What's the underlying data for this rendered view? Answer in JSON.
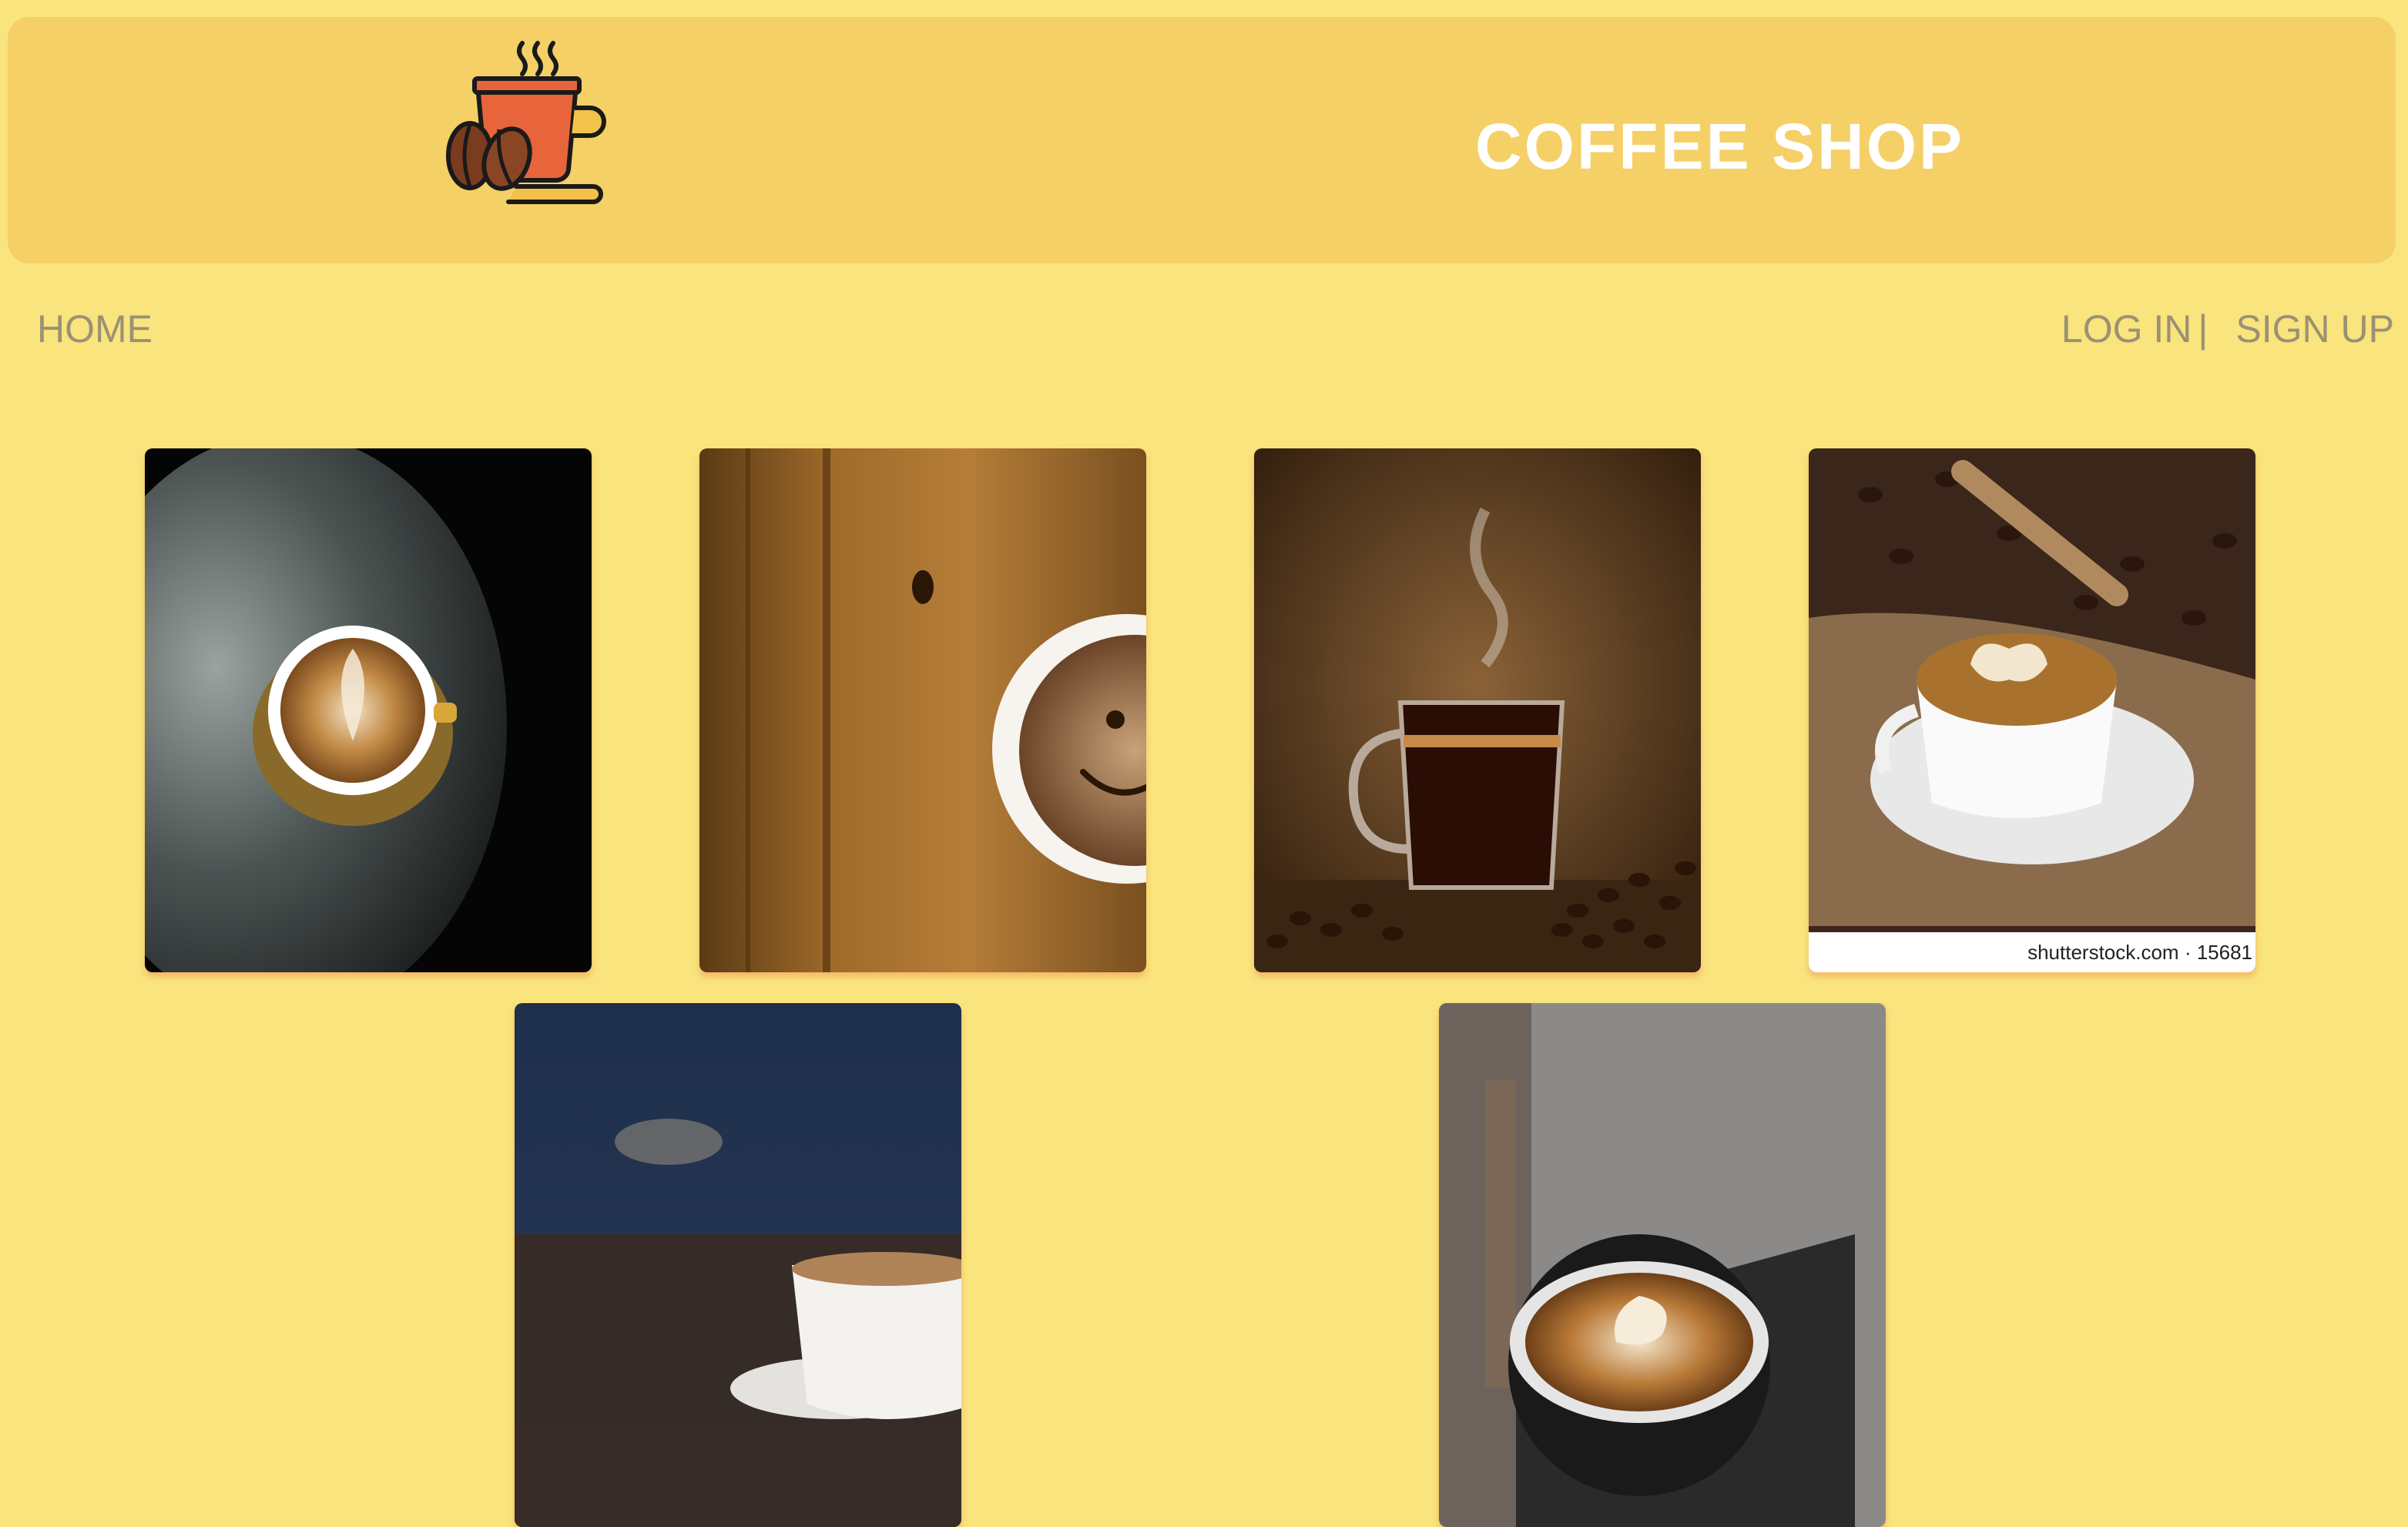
{
  "header": {
    "logo_icon": "coffee-cup-with-beans-icon",
    "title": "COFFEE SHOP"
  },
  "nav": {
    "home": "HOME",
    "login": "LOG IN",
    "separator": "|",
    "signup": "SIGN UP"
  },
  "gallery": [
    {
      "subject": "latte-art-cup-top-view"
    },
    {
      "subject": "smiley-coffee-on-wood"
    },
    {
      "subject": "black-coffee-glass-with-beans"
    },
    {
      "subject": "latte-on-coffee-beans"
    },
    {
      "subject": "coffee-cup-dark-blue-background"
    },
    {
      "subject": "latte-art-cup-espresso-machine"
    }
  ],
  "watermark_text": "shutterstock.com · 15681",
  "colors": {
    "background": "#f9e47d",
    "header": "#f5d066",
    "title": "#ffffff",
    "nav_text": "#9a9175"
  }
}
